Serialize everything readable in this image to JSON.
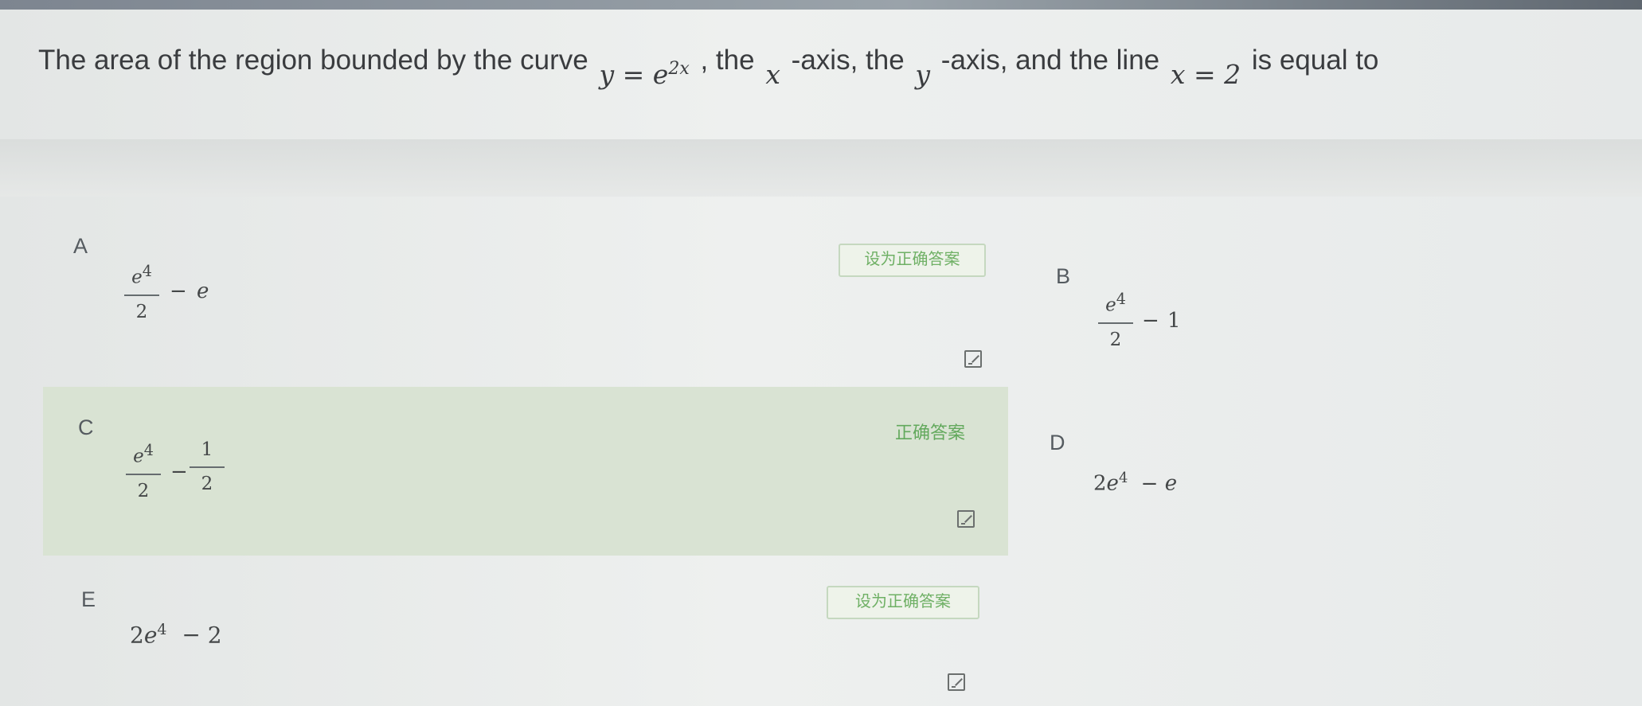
{
  "question": {
    "text_before_curve": "The area of the region bounded by the curve",
    "curve_lhs": "y",
    "curve_eq": " = e",
    "curve_exponent": "2x",
    "text_after_curve": ", the",
    "x_var": "x",
    "text_after_x": "-axis, the",
    "y_var": "y",
    "text_after_y": "-axis, and the line",
    "line_eq": "x = 2",
    "text_end": "is equal to"
  },
  "labels": {
    "set_correct": "设为正确答案",
    "correct": "正确答案"
  },
  "options": [
    {
      "letter": "A",
      "numerator": "e",
      "numerator_exp": "4",
      "denominator": "2",
      "operator": "−",
      "second": "e"
    },
    {
      "letter": "B",
      "numerator": "e",
      "numerator_exp": "4",
      "denominator": "2",
      "operator": "−",
      "second": "1"
    },
    {
      "letter": "C",
      "numerator": "e",
      "numerator_exp": "4",
      "denominator": "2",
      "operator": "−",
      "second_numerator": "1",
      "second_denominator": "2"
    },
    {
      "letter": "D",
      "coefficient": "2",
      "base": "e",
      "exponent": "4",
      "operator": "−",
      "second": "e"
    },
    {
      "letter": "E",
      "coefficient": "2",
      "base": "e",
      "exponent": "4",
      "operator": "−",
      "second": "2"
    }
  ]
}
